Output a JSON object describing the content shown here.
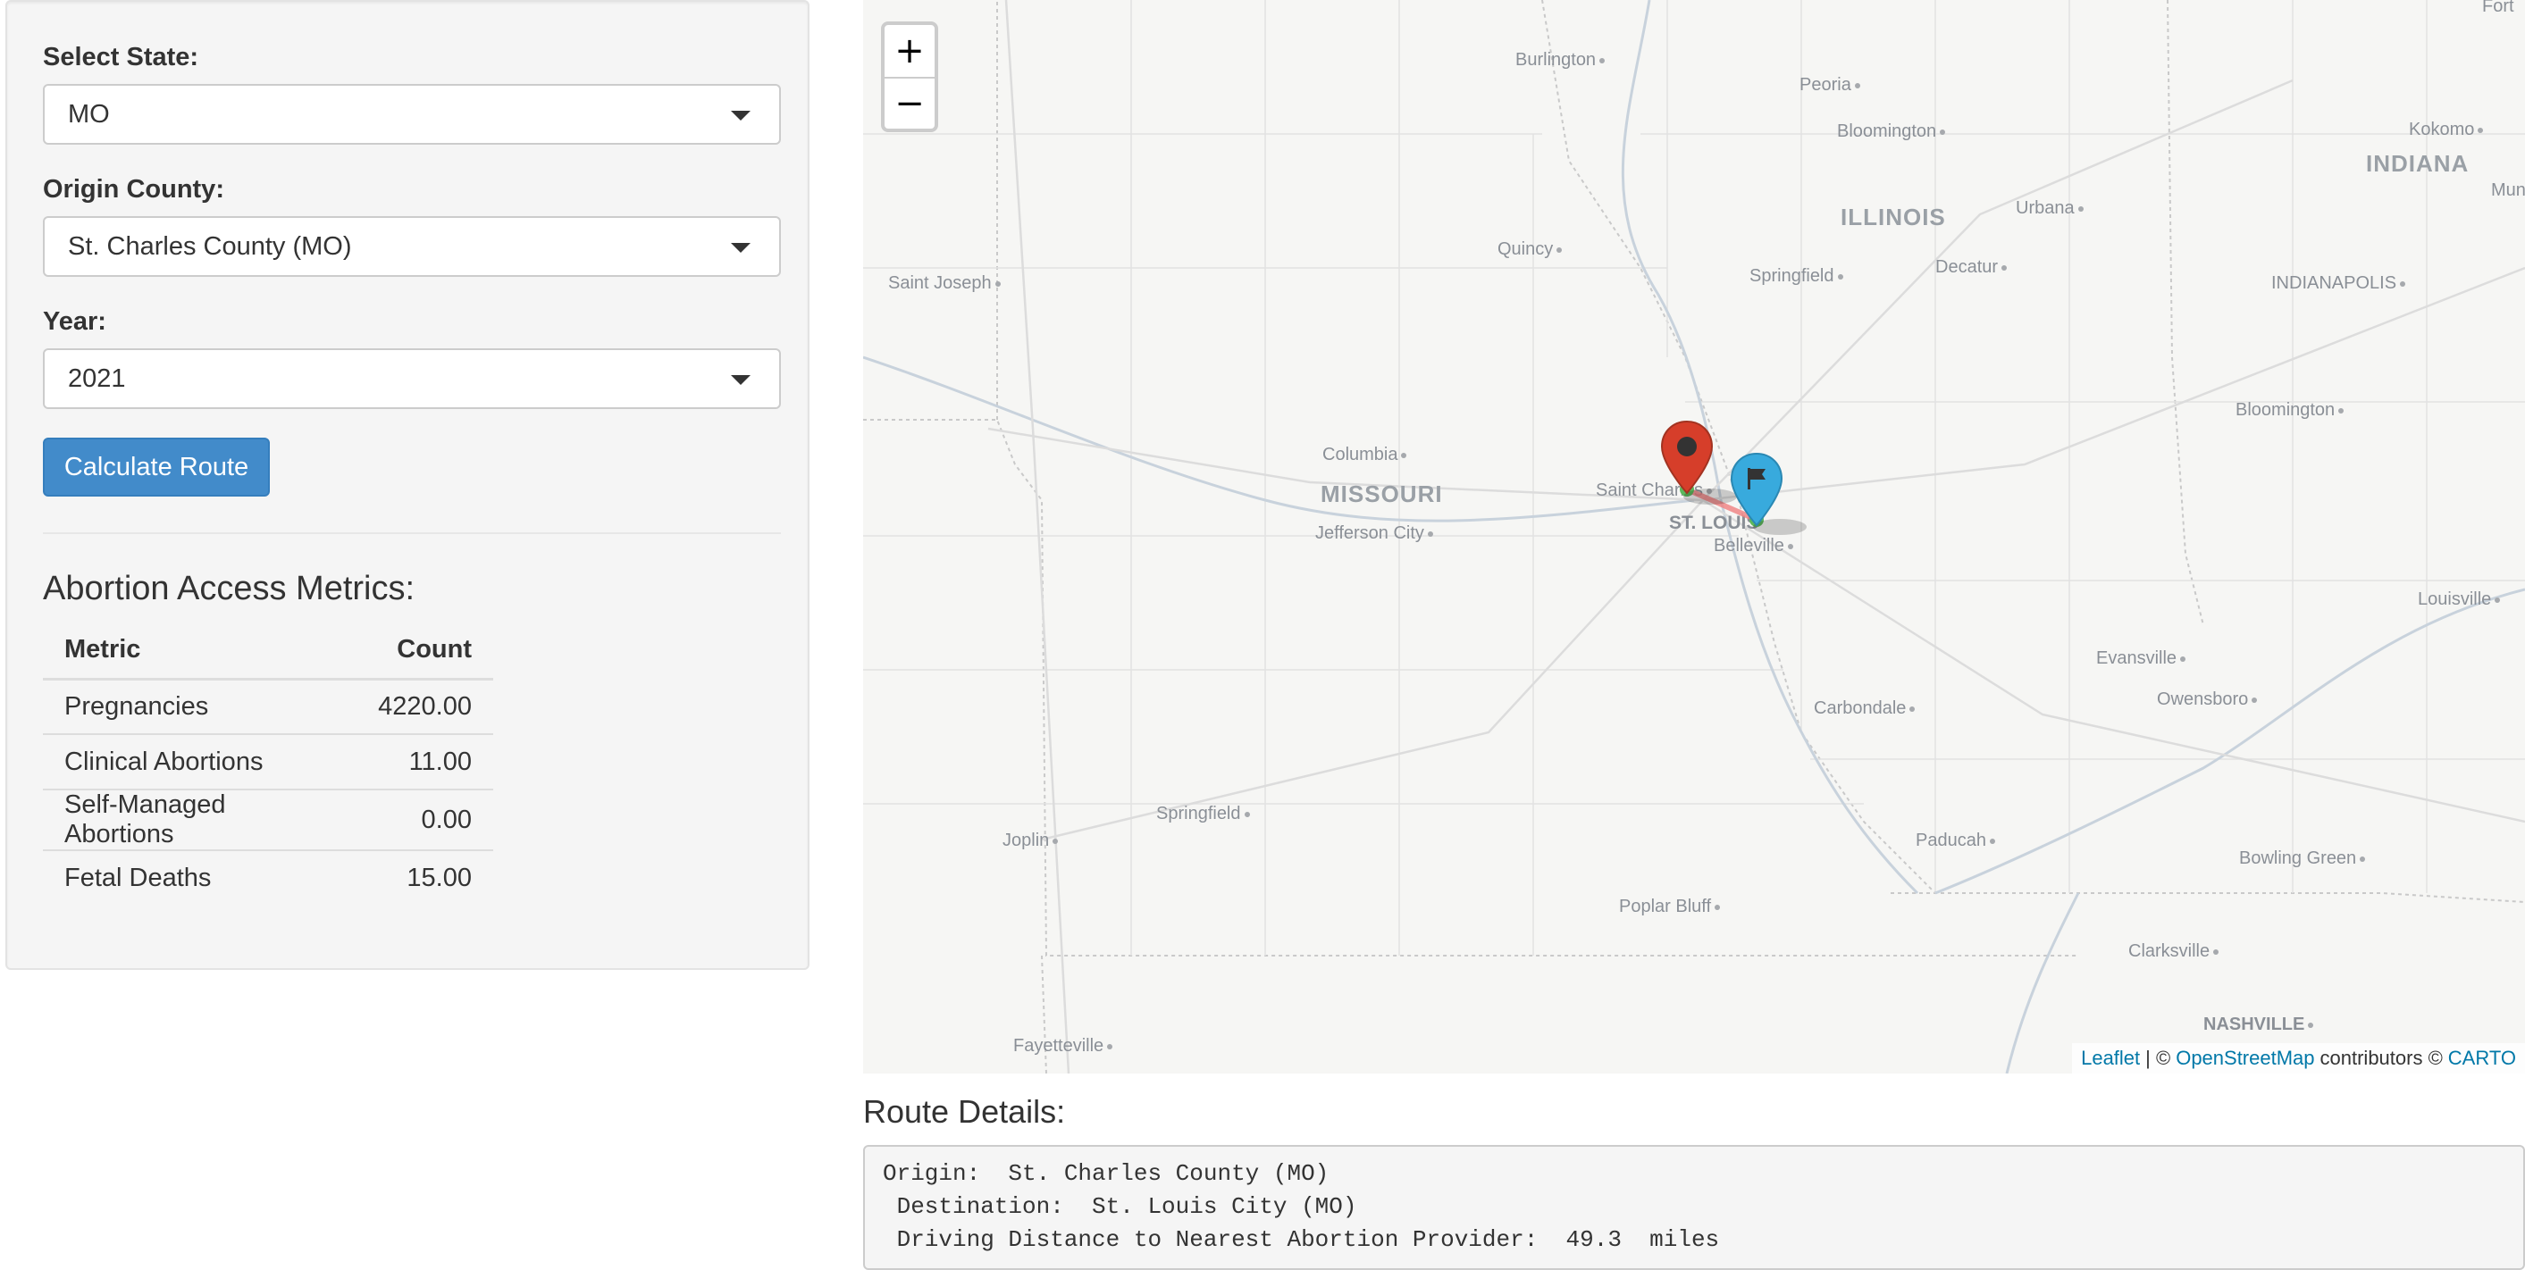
{
  "sidebar": {
    "state_label": "Select State:",
    "state_value": "MO",
    "county_label": "Origin County:",
    "county_value": "St. Charles County (MO)",
    "year_label": "Year:",
    "year_value": "2021",
    "calculate_button": "Calculate Route",
    "metrics_title": "Abortion Access Metrics:",
    "metrics_table": {
      "headers": [
        "Metric",
        "Count"
      ],
      "rows": [
        {
          "metric": "Pregnancies",
          "count": "4220.00"
        },
        {
          "metric": "Clinical Abortions",
          "count": "11.00"
        },
        {
          "metric": "Self-Managed Abortions",
          "count": "0.00"
        },
        {
          "metric": "Fetal Deaths",
          "count": "15.00"
        }
      ]
    }
  },
  "map": {
    "zoom_in": "+",
    "zoom_out": "−",
    "state_labels": [
      "MISSOURI",
      "ILLINOIS",
      "INDIANA"
    ],
    "city_labels": {
      "burlington": "Burlington",
      "peoria": "Peoria",
      "bloomington_il": "Bloomington",
      "kokomo": "Kokomo",
      "munc": "Munc",
      "fort": "Fort",
      "urbana": "Urbana",
      "quincy": "Quincy",
      "springfield_il": "Springfield",
      "decatur": "Decatur",
      "indianapolis": "INDIANAPOLIS",
      "saint_joseph": "Saint Joseph",
      "bloomington_in": "Bloomington",
      "columbia": "Columbia",
      "jefferson_city": "Jefferson City",
      "saint_charles": "Saint Charles",
      "st_louis": "ST. LOUIS",
      "belleville": "Belleville",
      "louisville": "Louisville",
      "evansville": "Evansville",
      "owensboro": "Owensboro",
      "carbondale": "Carbondale",
      "springfield_mo": "Springfield",
      "joplin": "Joplin",
      "paducah": "Paducah",
      "bowling_green": "Bowling Green",
      "poplar_bluff": "Poplar Bluff",
      "clarksville": "Clarksville",
      "nashville": "NASHVILLE",
      "fayetteville": "Fayetteville"
    },
    "origin_marker_icon": "circle-marker-icon",
    "destination_marker_icon": "flag-icon",
    "marker_colors": {
      "origin": "#d63e2a",
      "destination": "#38aadd",
      "route_line": "#f08080"
    },
    "attribution": {
      "leaflet": "Leaflet",
      "sep1": "| ©",
      "osm": "OpenStreetMap",
      "contributors": "contributors ©",
      "carto": "CARTO"
    }
  },
  "route_details": {
    "title": "Route Details:",
    "lines": [
      "Origin:  St. Charles County (MO)",
      " Destination:  St. Louis City (MO)",
      " Driving Distance to Nearest Abortion Provider:  49.3  miles"
    ]
  }
}
